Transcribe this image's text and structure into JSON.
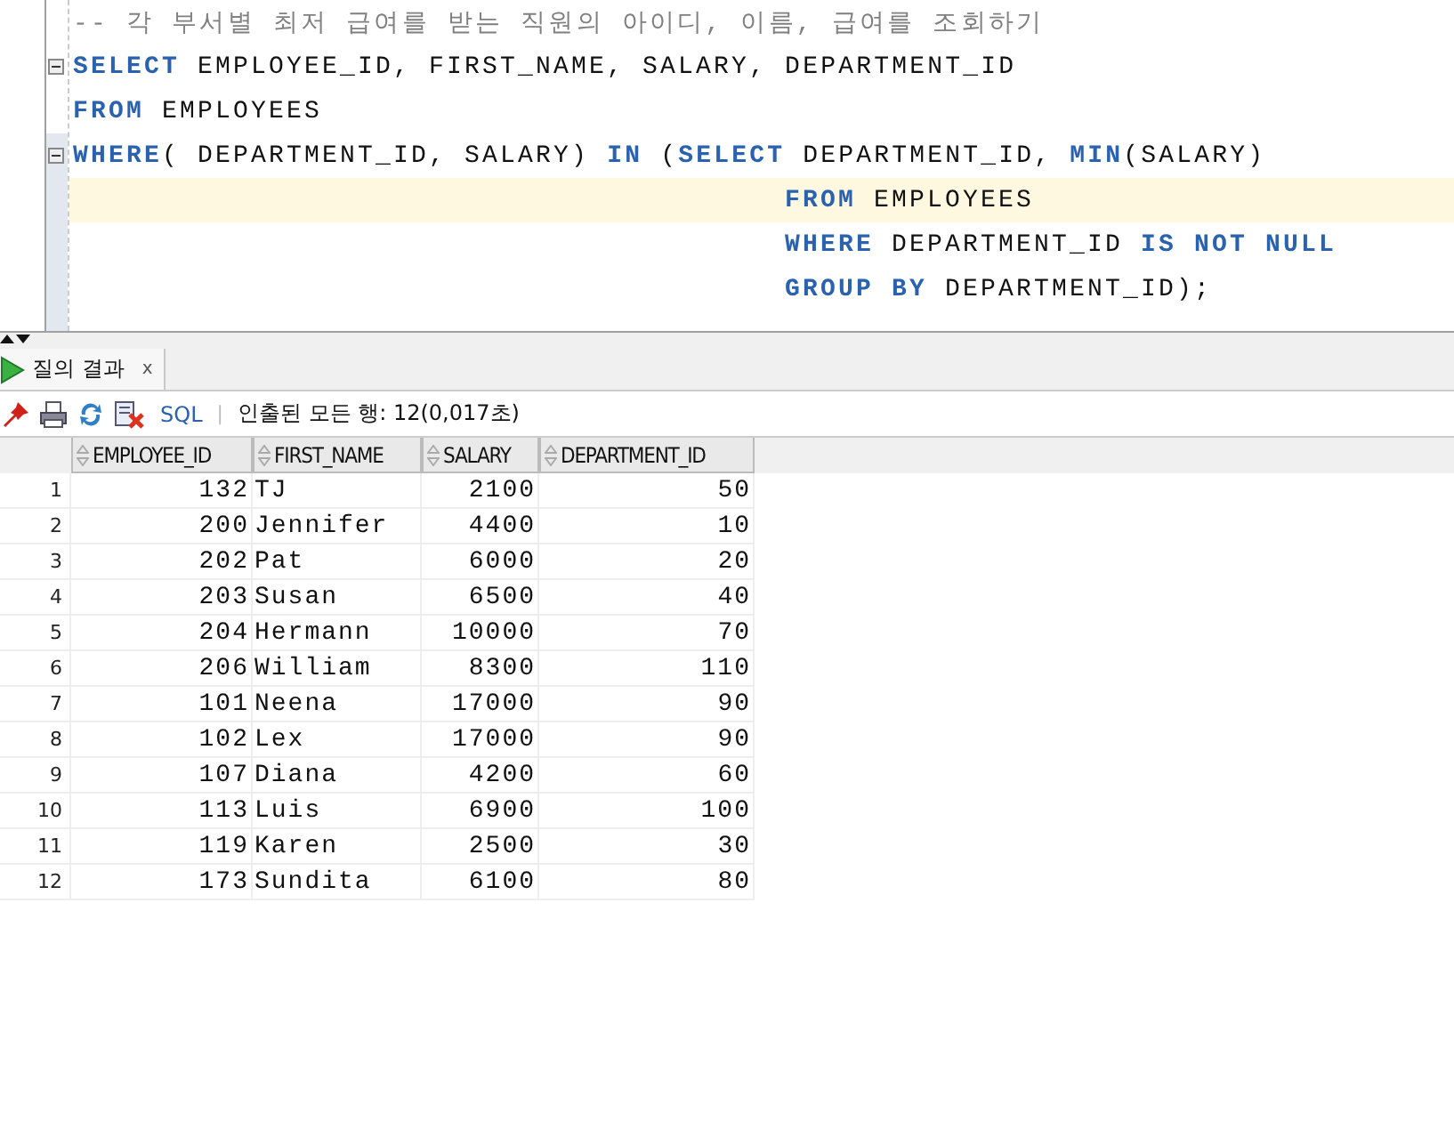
{
  "editor": {
    "lines": [
      {
        "foldable": false,
        "current": false,
        "indented": false,
        "tokens": [
          {
            "kind": "comment",
            "text": "-- 각 부서별 최저 급여를 받는 직원의 아이디, 이름, 급여를 조회하기"
          }
        ]
      },
      {
        "foldable": true,
        "current": false,
        "indented": false,
        "tokens": [
          {
            "kind": "keyword",
            "text": "SELECT"
          },
          {
            "kind": "plain",
            "text": " EMPLOYEE_ID, FIRST_NAME, SALARY, DEPARTMENT_ID"
          }
        ]
      },
      {
        "foldable": false,
        "current": false,
        "indented": false,
        "tokens": [
          {
            "kind": "keyword",
            "text": "FROM"
          },
          {
            "kind": "plain",
            "text": " EMPLOYEES"
          }
        ]
      },
      {
        "foldable": true,
        "current": false,
        "indented": false,
        "tokens": [
          {
            "kind": "keyword",
            "text": "WHERE"
          },
          {
            "kind": "plain",
            "text": "( DEPARTMENT_ID, SALARY) "
          },
          {
            "kind": "keyword",
            "text": "IN"
          },
          {
            "kind": "plain",
            "text": " ("
          },
          {
            "kind": "keyword",
            "text": "SELECT"
          },
          {
            "kind": "plain",
            "text": " DEPARTMENT_ID, "
          },
          {
            "kind": "keyword",
            "text": "MIN"
          },
          {
            "kind": "plain",
            "text": "(SALARY)"
          }
        ]
      },
      {
        "foldable": false,
        "current": true,
        "indented": true,
        "tokens": [
          {
            "kind": "keyword",
            "text": "FROM"
          },
          {
            "kind": "plain",
            "text": " EMPLOYEES"
          }
        ]
      },
      {
        "foldable": false,
        "current": false,
        "indented": true,
        "tokens": [
          {
            "kind": "keyword",
            "text": "WHERE"
          },
          {
            "kind": "plain",
            "text": " DEPARTMENT_ID "
          },
          {
            "kind": "keyword",
            "text": "IS NOT NULL"
          }
        ]
      },
      {
        "foldable": false,
        "current": false,
        "indented": true,
        "tokens": [
          {
            "kind": "keyword",
            "text": "GROUP BY"
          },
          {
            "kind": "plain",
            "text": " DEPARTMENT_ID);"
          }
        ]
      }
    ]
  },
  "results_tab": {
    "label": "질의 결과",
    "close": "x",
    "selected": true
  },
  "toolbar": {
    "sql_link": "SQL",
    "separator": "|",
    "status": "인출된 모든 행: 12(0,017초)"
  },
  "table": {
    "columns": [
      "EMPLOYEE_ID",
      "FIRST_NAME",
      "SALARY",
      "DEPARTMENT_ID"
    ],
    "rows": [
      {
        "num": "1",
        "cells": [
          "132",
          "TJ",
          "2100",
          "50"
        ]
      },
      {
        "num": "2",
        "cells": [
          "200",
          "Jennifer",
          "4400",
          "10"
        ]
      },
      {
        "num": "3",
        "cells": [
          "202",
          "Pat",
          "6000",
          "20"
        ]
      },
      {
        "num": "4",
        "cells": [
          "203",
          "Susan",
          "6500",
          "40"
        ]
      },
      {
        "num": "5",
        "cells": [
          "204",
          "Hermann",
          "10000",
          "70"
        ]
      },
      {
        "num": "6",
        "cells": [
          "206",
          "William",
          "8300",
          "110"
        ]
      },
      {
        "num": "7",
        "cells": [
          "101",
          "Neena",
          "17000",
          "90"
        ]
      },
      {
        "num": "8",
        "cells": [
          "102",
          "Lex",
          "17000",
          "90"
        ]
      },
      {
        "num": "9",
        "cells": [
          "107",
          "Diana",
          "4200",
          "60"
        ]
      },
      {
        "num": "10",
        "cells": [
          "113",
          "Luis",
          "6900",
          "100"
        ]
      },
      {
        "num": "11",
        "cells": [
          "119",
          "Karen",
          "2500",
          "30"
        ]
      },
      {
        "num": "12",
        "cells": [
          "173",
          "Sundita",
          "6100",
          "80"
        ]
      }
    ]
  }
}
